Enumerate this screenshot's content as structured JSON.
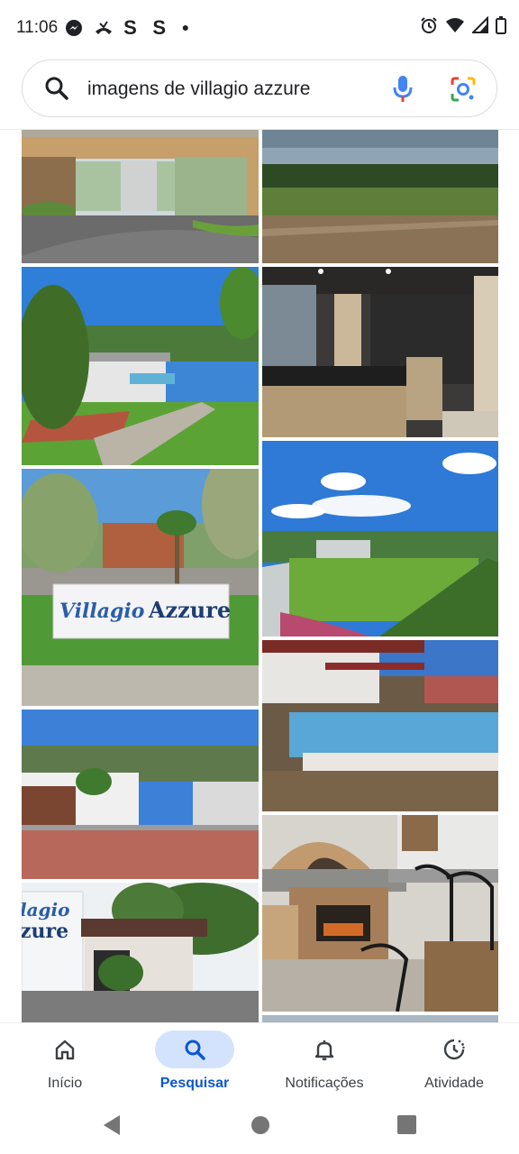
{
  "status_bar": {
    "time": "11:06",
    "notification_icons": [
      "messenger-icon",
      "missed-call-icon",
      "s-app-icon",
      "s-app-icon",
      "dot-icon"
    ],
    "system_icons": [
      "alarm-icon",
      "wifi-icon",
      "signal-icon",
      "battery-icon"
    ]
  },
  "search": {
    "query": "imagens de villagio azzure"
  },
  "results": {
    "sign_text_line1": "Villagio",
    "sign_text_line2": "Azzure",
    "partial_sign_line1": "lagio",
    "partial_sign_line2": "zure"
  },
  "bottom_nav": {
    "items": [
      {
        "label": "Início",
        "icon": "home-icon",
        "active": false
      },
      {
        "label": "Pesquisar",
        "icon": "search-icon",
        "active": true
      },
      {
        "label": "Notificações",
        "icon": "bell-icon",
        "active": false
      },
      {
        "label": "Atividade",
        "icon": "activity-icon",
        "active": false
      }
    ]
  },
  "colors": {
    "accent": "#0b57d0",
    "active_pill": "#d3e3fd",
    "mic_blue": "#4285f4",
    "mic_red": "#ea4335",
    "lens_yellow": "#fbbc04",
    "lens_green": "#34a853"
  }
}
